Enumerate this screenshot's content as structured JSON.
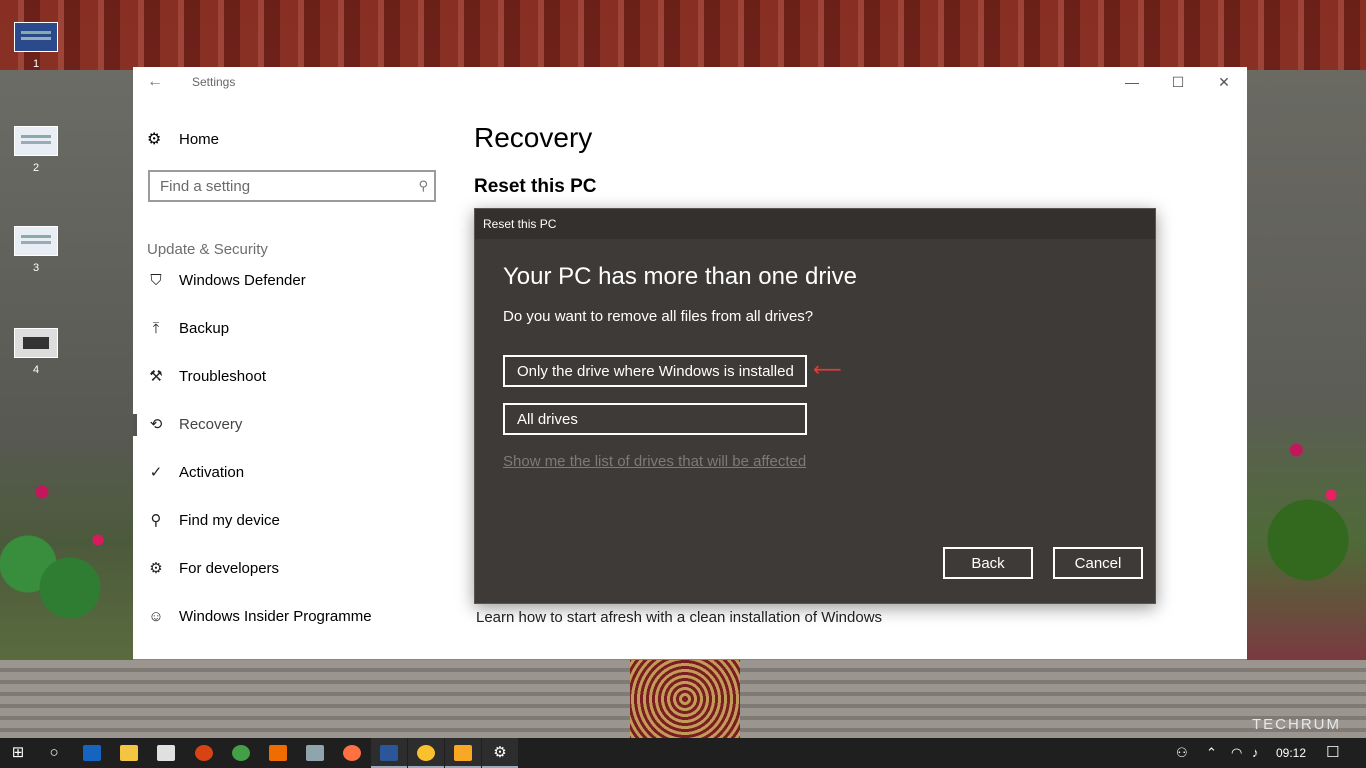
{
  "desktop": {
    "icons": [
      {
        "label": "1"
      },
      {
        "label": "2"
      },
      {
        "label": "3"
      },
      {
        "label": "4"
      }
    ],
    "watermark": "TECHRUM"
  },
  "window": {
    "title": "Settings",
    "controls": {
      "minimize": "—",
      "maximize": "☐",
      "close": "✕"
    }
  },
  "nav": {
    "home_label": "Home",
    "search_placeholder": "Find a setting",
    "section_label": "Update & Security",
    "items": [
      {
        "label": "Windows Defender",
        "icon": "shield-icon",
        "glyph": "⛉"
      },
      {
        "label": "Backup",
        "icon": "upload-arrow-icon",
        "glyph": "⤒"
      },
      {
        "label": "Troubleshoot",
        "icon": "wrench-icon",
        "glyph": "⚒"
      },
      {
        "label": "Recovery",
        "icon": "history-icon",
        "glyph": "⟲",
        "selected": true
      },
      {
        "label": "Activation",
        "icon": "check-circle-icon",
        "glyph": "✓"
      },
      {
        "label": "Find my device",
        "icon": "person-location-icon",
        "glyph": "⚲"
      },
      {
        "label": "For developers",
        "icon": "developer-tools-icon",
        "glyph": "⚙"
      },
      {
        "label": "Windows Insider Programme",
        "icon": "insider-cat-icon",
        "glyph": "☺"
      }
    ]
  },
  "content": {
    "page_title": "Recovery",
    "section_title": "Reset this PC",
    "learn_link": "Learn how to start afresh with a clean installation of Windows"
  },
  "dialog": {
    "title": "Reset this PC",
    "heading": "Your PC has more than one drive",
    "question": "Do you want to remove all files from all drives?",
    "option_1": "Only the drive where Windows is installed",
    "option_2": "All drives",
    "drives_link": "Show me the list of drives that will be affected",
    "back_button": "Back",
    "cancel_button": "Cancel"
  },
  "taskbar": {
    "clock": "09:12",
    "accent_color": "#9ab"
  }
}
